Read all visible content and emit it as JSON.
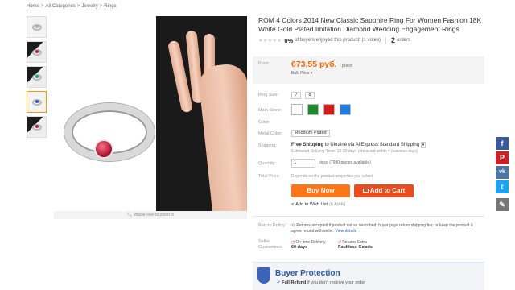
{
  "breadcrumb": [
    "Home",
    "All Categories",
    "Jewelry",
    "Rings"
  ],
  "breadcrumb_sep": ">",
  "product": {
    "title": "ROM 4 Colors 2014 New Classic Sapphire Ring For Women Fashion 18K White Gold Plated Imitation Diamond Wedding Engagement Rings",
    "stars": "★★★★★",
    "buyer_pct": "0%",
    "buyer_text": "of buyers enjoyed this product! (1 votes)",
    "orders_count": "2",
    "orders_label": "orders"
  },
  "image": {
    "zoom_hint": "Mouse over to zoom in"
  },
  "price": {
    "label": "Price:",
    "value": "673,55 руб.",
    "per": "/ piece",
    "bulk": "Bulk Price ▾"
  },
  "options": {
    "ring_size_label": "Ring Size:",
    "ring_sizes": [
      "7",
      "8"
    ],
    "main_stone_label": "Main Stone:",
    "main_stone_colors": [
      "#ffffff",
      "#1a8a2c",
      "#d61a1a",
      "#1f7be0"
    ],
    "color_label": "Color:",
    "metal_label": "Metal Color:",
    "metal_value": "Rhodium Plated",
    "shipping_label": "Shipping:",
    "shipping_bold": "Free Shipping",
    "shipping_rest": "to Ukraine via AliExpress Standard Shipping",
    "delivery": "Estimated Delivery Time: 15-30 days (ships out within 4 business days)",
    "quantity_label": "Quantity:",
    "quantity_value": "1",
    "quantity_note": "piece (7980 pieces available)",
    "total_label": "Total Price:",
    "total_note": "Depends on the product properties you select"
  },
  "actions": {
    "buy_now": "Buy Now",
    "add_to_cart": "Add to Cart",
    "wishlist": "Add to Wish List",
    "wishlist_count": "(6 Adds)"
  },
  "policy": {
    "label": "Return Policy:",
    "text": "Returns accepted if product not as described, buyer pays return shipping fee; or keep the product & agree refund with seller.",
    "link": "View details"
  },
  "guarantees": {
    "label": "Seller Guarantees:",
    "items": [
      {
        "title": "On-time Delivery",
        "value": "60 days"
      },
      {
        "title": "Returns Extra",
        "value": "Faultless Goods"
      }
    ]
  },
  "buyer_protection": {
    "title": "Buyer Protection",
    "line_bold": "Full Refund",
    "line_rest": "if you don't receive your order"
  },
  "share": [
    "f",
    "P",
    "vk",
    "t",
    "✎"
  ]
}
